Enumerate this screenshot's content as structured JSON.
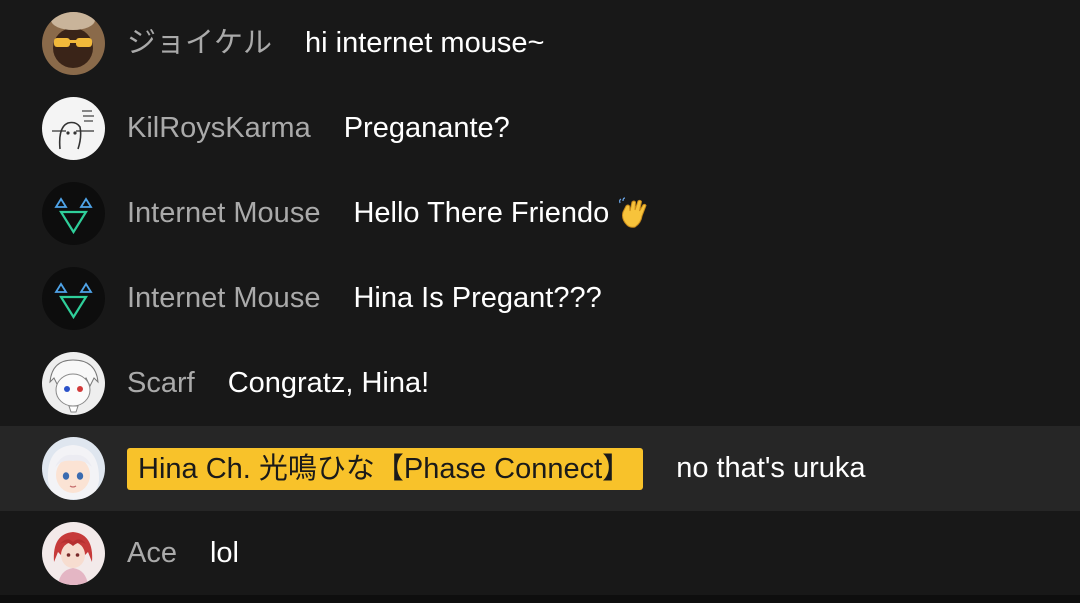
{
  "chat": {
    "messages": [
      {
        "author": "ジョイケル",
        "text": "hi internet mouse~",
        "avatar": "avatar-photo-sunglasses"
      },
      {
        "author": "KilRoysKarma",
        "text": "Preganante?",
        "avatar": "avatar-sketch-doodle"
      },
      {
        "author": "Internet Mouse",
        "text": "Hello There Friendo",
        "emoji": "waving-hand-emoji",
        "avatar": "avatar-triangle-mouse"
      },
      {
        "author": "Internet Mouse",
        "text": "Hina Is Pregant???",
        "avatar": "avatar-triangle-mouse"
      },
      {
        "author": "Scarf",
        "text": "Congratz, Hina!",
        "avatar": "avatar-anime-character"
      },
      {
        "author": "Hina Ch. 光鳴ひな【Phase Connect】",
        "text": "no that's uruka",
        "avatar": "avatar-anime-girl-white-hair",
        "owner_badge": true
      },
      {
        "author": "Ace",
        "text": "lol",
        "avatar": "avatar-red-hair-character"
      }
    ]
  },
  "colors": {
    "background": "#181818",
    "highlight_row": "#262626",
    "author_name": "#aaaaaa",
    "message_text": "#ffffff",
    "owner_badge": "#f8c22a"
  }
}
